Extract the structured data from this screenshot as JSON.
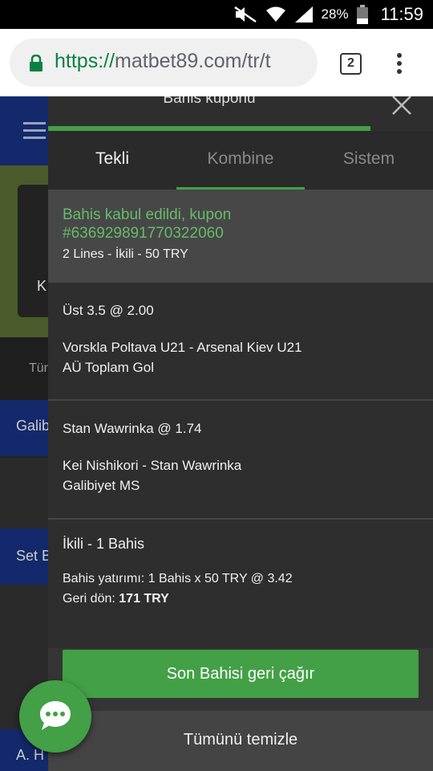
{
  "status_bar": {
    "battery_pct": "28%",
    "time": "11:59",
    "icons": [
      "mute-icon",
      "wifi-icon",
      "signal-icon",
      "battery-icon"
    ]
  },
  "browser": {
    "url_scheme": "https://",
    "url_rest": "matbet89.com/tr/t",
    "tab_count": "2",
    "accent": "#0b8043"
  },
  "background_page": {
    "card_text": "K",
    "tab_text": "Tür",
    "section1": "Galib",
    "section2": "Set B",
    "section3": "A. H"
  },
  "coupon": {
    "title": "Bahis kuponu",
    "tabs": [
      {
        "label": "Tekli"
      },
      {
        "label": "Kombine"
      },
      {
        "label": "Sistem"
      }
    ],
    "confirmation": {
      "line1": "Bahis kabul edildi, kupon",
      "line2": "#636929891770322060",
      "lines": "2 Lines - İkili - 50 TRY"
    },
    "selections": [
      {
        "pick": "Üst  3.5  @ 2.00",
        "event": "Vorskla Poltava U21 - Arsenal Kiev U21",
        "market": "AÜ Toplam Gol"
      },
      {
        "pick": "Stan Wawrinka  @ 1.74",
        "event": "Kei Nishikori - Stan Wawrinka",
        "market": "Galibiyet MS"
      }
    ],
    "summary": {
      "type": "İkili - 1 Bahis",
      "stake": "Bahis yatırımı:  1 Bahis x 50 TRY  @ 3.42",
      "return_label": "Geri dön:",
      "return_value": "171 TRY"
    },
    "recall_button": "Son Bahisi geri çağır",
    "clear_button": "Tümünü temizle",
    "colors": {
      "green": "#43a047",
      "confirm_text": "#66bb6a",
      "panel": "#2e2e2e"
    }
  }
}
